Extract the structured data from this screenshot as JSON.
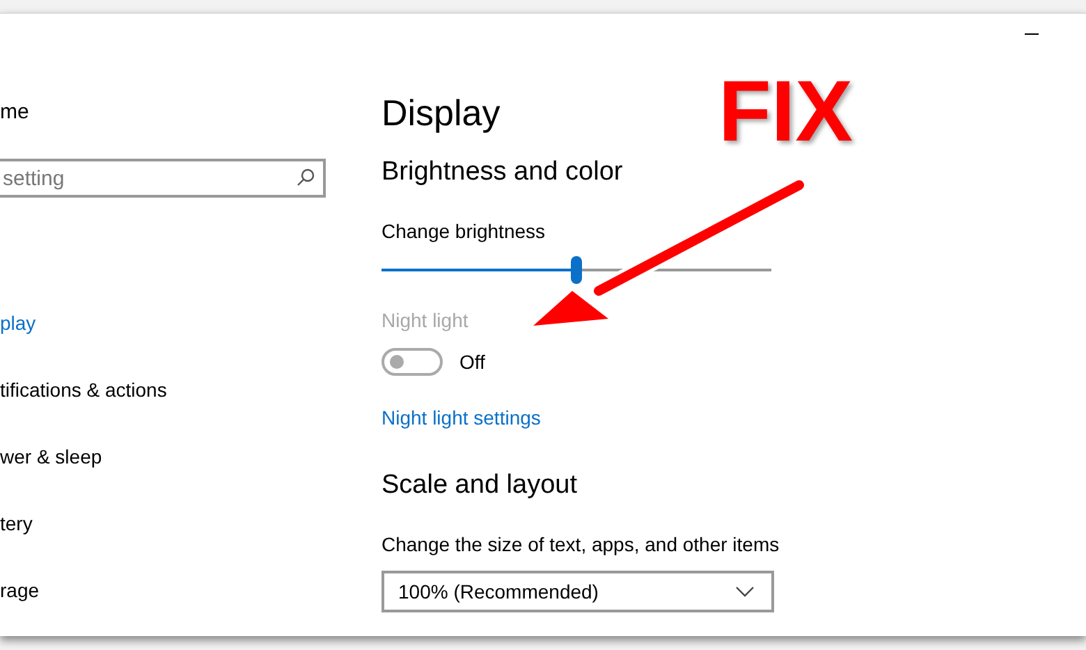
{
  "sidebar": {
    "home_label": "me",
    "search": {
      "placeholder": "setting"
    },
    "items": [
      {
        "label": "play",
        "selected": true
      },
      {
        "label": "tifications & actions",
        "selected": false
      },
      {
        "label": "wer & sleep",
        "selected": false
      },
      {
        "label": "tery",
        "selected": false
      },
      {
        "label": "rage",
        "selected": false
      }
    ]
  },
  "main": {
    "title": "Display",
    "brightness_section": "Brightness and color",
    "brightness_label": "Change brightness",
    "brightness": {
      "level": 0.5
    },
    "night_light": {
      "label": "Night light",
      "on": false,
      "disabled": true,
      "state_text": "Off"
    },
    "night_light_link": "Night light settings",
    "scale_section": "Scale and layout",
    "size_label": "Change the size of text, apps, and other items",
    "size_dropdown": {
      "value": "100% (Recommended)"
    }
  },
  "annotation": {
    "text": "FIX"
  }
}
